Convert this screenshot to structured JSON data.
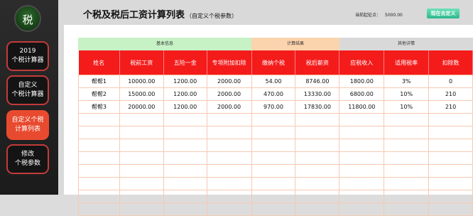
{
  "sidebar": {
    "logo_char": "税",
    "items": [
      {
        "line1": "2019",
        "line2": "个税计算器"
      },
      {
        "line1": "自定义",
        "line2": "个税计算器"
      },
      {
        "line1": "自定义个税",
        "line2": "计算列表"
      },
      {
        "line1": "修改",
        "line2": "个税参数"
      }
    ],
    "active_index": 2
  },
  "header": {
    "title": "个税及税后工资计算列表",
    "subtitle": "（自定义个税参数）",
    "threshold_label": "当前起征点：",
    "threshold_value": "5000.00",
    "custom_button": "现在去定义"
  },
  "table": {
    "groups": [
      "基本信息",
      "计算结果",
      "其他详情"
    ],
    "group_colors": [
      "#c6f2c6",
      "#fbd3ad",
      "#d9d9d9"
    ],
    "header_color": "#f41b1b",
    "columns": [
      "姓名",
      "税前工资",
      "五险一金",
      "专项附加扣除",
      "缴纳个税",
      "税后薪资",
      "应税收入",
      "适用税率",
      "扣除数"
    ],
    "rows": [
      [
        "帮帮1",
        "10000.00",
        "1200.00",
        "2000.00",
        "54.00",
        "8746.00",
        "1800.00",
        "3%",
        "0"
      ],
      [
        "帮帮2",
        "15000.00",
        "1200.00",
        "2000.00",
        "470.00",
        "13330.00",
        "6800.00",
        "10%",
        "210"
      ],
      [
        "帮帮3",
        "20000.00",
        "1200.00",
        "2000.00",
        "970.00",
        "17830.00",
        "11800.00",
        "10%",
        "210"
      ]
    ],
    "empty_rows": 8
  }
}
